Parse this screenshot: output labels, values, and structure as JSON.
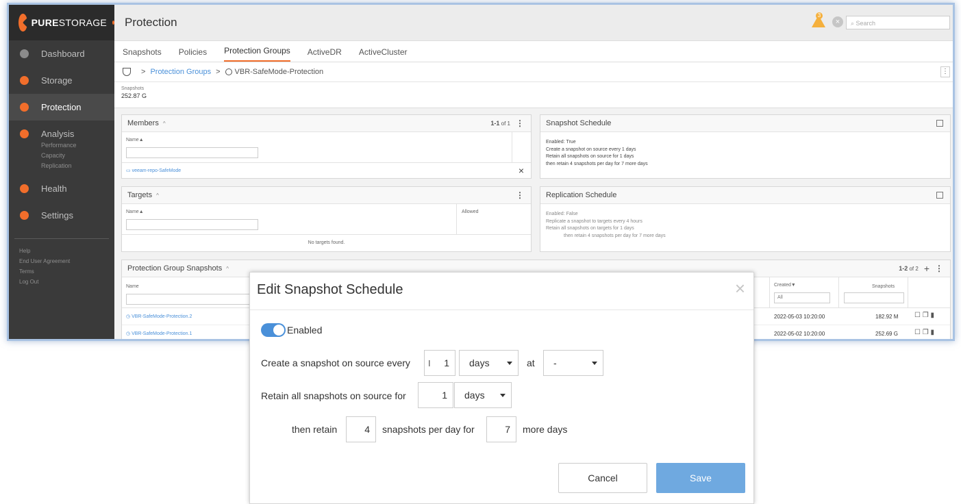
{
  "app": {
    "brand_bold": "PURE",
    "brand_light": "STORAGE",
    "page_title": "Protection",
    "alert_count": "3",
    "search_placeholder": "Search"
  },
  "sidebar": {
    "items": [
      {
        "label": "Dashboard"
      },
      {
        "label": "Storage"
      },
      {
        "label": "Protection"
      },
      {
        "label": "Analysis"
      },
      {
        "label": "Health"
      },
      {
        "label": "Settings"
      }
    ],
    "analysis_sub": [
      "Performance",
      "Capacity",
      "Replication"
    ],
    "footer_links": [
      "Help",
      "End User Agreement",
      "Terms",
      "Log Out"
    ]
  },
  "tabs": [
    "Snapshots",
    "Policies",
    "Protection Groups",
    "ActiveDR",
    "ActiveCluster"
  ],
  "breadcrumb": {
    "parent": "Protection Groups",
    "current": "VBR-SafeMode-Protection",
    "sep": ">"
  },
  "summary": {
    "label": "Snapshots",
    "value": "252.87 G"
  },
  "members": {
    "title": "Members",
    "count_bold": "1-1",
    "count_rest": "of 1",
    "col_name": "Name",
    "item": "veeam-repo-SafeMode",
    "remove": "×"
  },
  "targets": {
    "title": "Targets",
    "col_name": "Name",
    "col_allowed": "Allowed",
    "empty": "No targets found."
  },
  "snapshot_schedule": {
    "title": "Snapshot Schedule",
    "lines": [
      "Enabled: True",
      "Create a snapshot on source every 1 days",
      "Retain all snapshots on source for 1 days",
      "then retain 4 snapshots per day for 7 more days"
    ]
  },
  "replication_schedule": {
    "title": "Replication Schedule",
    "lines": [
      "Enabled: False",
      "Replicate a snapshot to targets every 4 hours",
      "Retain all snapshots on targets for 1 days",
      "then retain 4 snapshots per day for 7 more days"
    ]
  },
  "pg_snapshots": {
    "title": "Protection Group Snapshots",
    "count_bold": "1-2",
    "count_rest": "of 2",
    "col_name": "Name",
    "col_created": "Created",
    "col_snapshots": "Snapshots",
    "created_filter": "All",
    "rows": [
      {
        "name": "VBR-SafeMode-Protection.2",
        "created": "2022-05-03 10:20:00",
        "size": "182.92 M"
      },
      {
        "name": "VBR-SafeMode-Protection.1",
        "created": "2022-05-02 10:20:00",
        "size": "252.69 G"
      }
    ]
  },
  "modal": {
    "title": "Edit Snapshot Schedule",
    "close": "×",
    "enabled_label": "Enabled",
    "create_label": "Create a snapshot on source every",
    "create_value": "1",
    "create_unit": "days",
    "at_label": "at",
    "at_value": "-",
    "retain_label": "Retain all snapshots on source for",
    "retain_value": "1",
    "retain_unit": "days",
    "then_label": "then retain",
    "then_value": "4",
    "per_day_label": "snapshots per day for",
    "more_value": "7",
    "more_label": "more days",
    "cancel": "Cancel",
    "save": "Save"
  },
  "colors": {
    "accent": "#f16e2b",
    "link": "#4a90d9",
    "save_button": "#6fa9e0",
    "sidebar_bg": "#3a3a3a"
  }
}
